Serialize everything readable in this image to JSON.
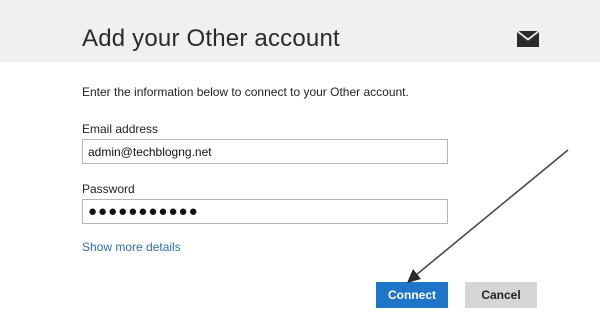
{
  "dialog": {
    "title": "Add your Other account",
    "icon": "mail-icon",
    "instructions": "Enter the information below to connect to your Other account."
  },
  "form": {
    "email": {
      "label": "Email address",
      "value": "admin@techblogng.net"
    },
    "password": {
      "label": "Password",
      "value": "●●●●●●●●●●●"
    },
    "show_more_link": "Show more details"
  },
  "buttons": {
    "connect": "Connect",
    "cancel": "Cancel"
  },
  "colors": {
    "header_bg": "#f0f0f0",
    "accent": "#1f76c9",
    "link": "#2f6fb4",
    "cancel_bg": "#d6d6d6"
  }
}
